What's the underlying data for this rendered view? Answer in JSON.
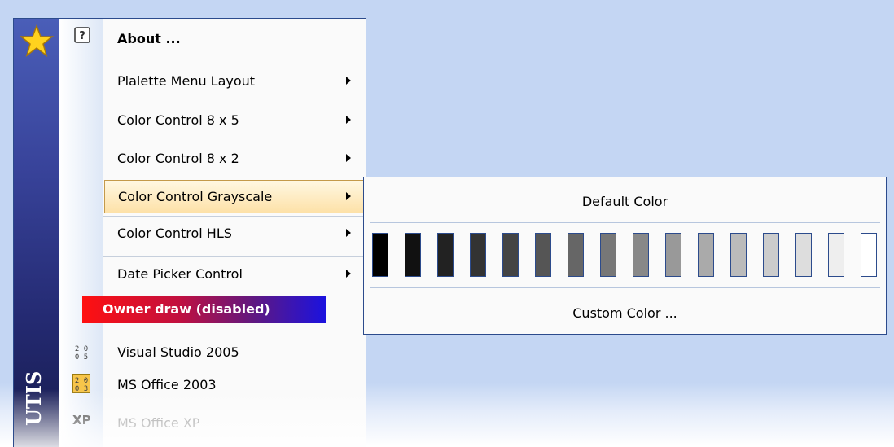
{
  "sidebar": {
    "text": "UTIS",
    "icon": "star-icon"
  },
  "menu": {
    "about_label": "About ...",
    "items": [
      {
        "label": "Plalette Menu Layout",
        "has_submenu": true
      },
      {
        "label": "Color Control 8 x 5",
        "has_submenu": true
      },
      {
        "label": "Color Control 8 x 2",
        "has_submenu": true
      },
      {
        "label": "Color Control Grayscale",
        "has_submenu": true,
        "highlighted": true
      },
      {
        "label": "Color Control HLS",
        "has_submenu": true
      },
      {
        "label": "Date Picker Control",
        "has_submenu": true
      }
    ],
    "owner_draw": "Owner draw (disabled)",
    "style_items": [
      {
        "label": "Visual Studio 2005",
        "icon": "vs2005-icon"
      },
      {
        "label": "MS Office 2003",
        "icon": "office2003-icon"
      },
      {
        "label": "MS Office XP",
        "icon": "officexp-icon",
        "icon_text": "XP"
      }
    ]
  },
  "submenu": {
    "default_label": "Default Color",
    "custom_label": "Custom Color ...",
    "swatches": [
      "#000000",
      "#111111",
      "#222222",
      "#333333",
      "#444444",
      "#555555",
      "#666666",
      "#777777",
      "#888888",
      "#999999",
      "#aaaaaa",
      "#bbbbbb",
      "#cccccc",
      "#dddddd",
      "#eeeeee",
      "#ffffff"
    ]
  },
  "colors": {
    "highlight": "#fde1a8",
    "border": "#2c4b8c",
    "background": "#c4d6f3"
  }
}
